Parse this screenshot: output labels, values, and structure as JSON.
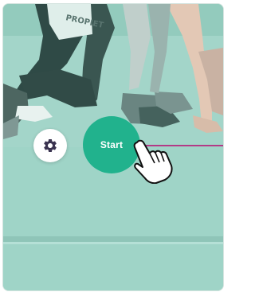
{
  "start_label": "Start",
  "photo_text": "PROPIET",
  "colors": {
    "start_button": "#21b28d",
    "overlay": "#a6d6cb",
    "guide_line": "#b23a86",
    "settings_icon": "#3a3350"
  },
  "icons": {
    "settings": "gear-icon",
    "cursor": "hand-pointer-icon"
  }
}
